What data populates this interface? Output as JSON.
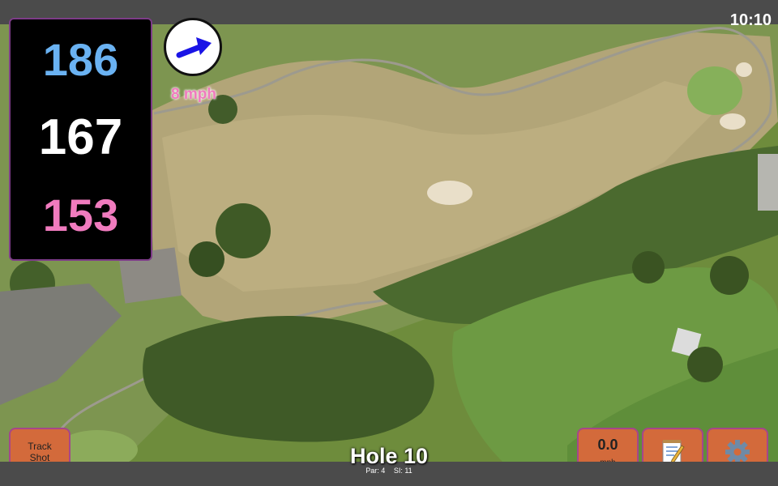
{
  "status": {
    "time": "10:10"
  },
  "distances": {
    "back": "186",
    "middle": "167",
    "front": "153"
  },
  "wind": {
    "speed": "8 mph",
    "direction_icon": "arrow-right-up"
  },
  "track_button": {
    "label": "Track\nShot"
  },
  "speed_box": {
    "value": "0.0",
    "unit": "mph"
  },
  "hole": {
    "title": "Hole 10",
    "par": "Par: 4",
    "si": "SI: 11"
  },
  "colors": {
    "back": "#6ab2f2",
    "middle": "#ffffff",
    "front": "#f07bbe",
    "button": "#d36a3b",
    "panel_border": "#7d3c88"
  }
}
